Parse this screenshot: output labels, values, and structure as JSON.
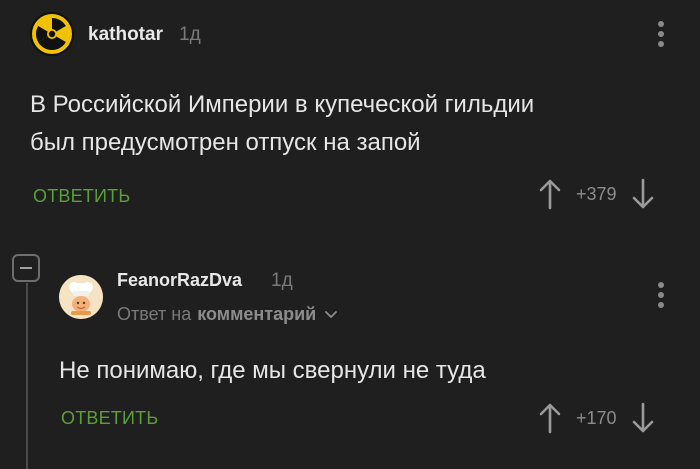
{
  "comments": [
    {
      "username": "kathotar",
      "time": "1д",
      "text_lines": [
        "В Российской Империи в купеческой гильдии",
        "был предусмотрен отпуск на запой"
      ],
      "reply_label": "ОТВЕТИТЬ",
      "rating": "+379",
      "avatar_icon": "radiation-icon"
    },
    {
      "username": "FeanorRazDva",
      "time": "1д",
      "reply_to_prefix": "Ответ на",
      "reply_to_link": "комментарий",
      "text_lines": [
        "Не понимаю, где мы свернули не туда"
      ],
      "reply_label": "ОТВЕТИТЬ",
      "rating": "+170",
      "avatar_icon": "chef-avatar-icon"
    }
  ],
  "colors": {
    "background": "#1f1f1f",
    "reply_green": "#5d9e3a",
    "muted": "#7a7a7a"
  }
}
